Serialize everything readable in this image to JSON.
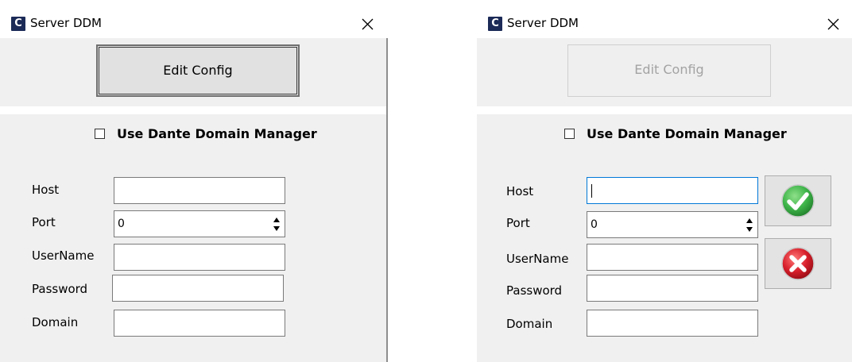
{
  "windows": [
    {
      "title": "Server DDM",
      "app_icon_letter": "C",
      "edit_config_label": "Edit Config",
      "use_ddm_label": "Use Dante Domain Manager",
      "fields": {
        "host": {
          "label": "Host",
          "value": ""
        },
        "port": {
          "label": "Port",
          "value": "0"
        },
        "username": {
          "label": "UserName",
          "value": ""
        },
        "password": {
          "label": "Password",
          "value": ""
        },
        "domain": {
          "label": "Domain",
          "value": ""
        }
      }
    },
    {
      "title": "Server DDM",
      "app_icon_letter": "C",
      "edit_config_label": "Edit Config",
      "use_ddm_label": "Use Dante Domain Manager",
      "fields": {
        "host": {
          "label": "Host",
          "value": ""
        },
        "port": {
          "label": "Port",
          "value": "0"
        },
        "username": {
          "label": "UserName",
          "value": ""
        },
        "password": {
          "label": "Password",
          "value": ""
        },
        "domain": {
          "label": "Domain",
          "value": ""
        }
      },
      "confirm_icon": "green-checkmark-icon",
      "cancel_icon": "red-x-icon"
    }
  ],
  "colors": {
    "panel": "#f0f0f0",
    "app_icon": "#1b2a57",
    "confirm_green": "#3fb54a",
    "cancel_red": "#d8202c",
    "focus_border": "#0078d7"
  }
}
